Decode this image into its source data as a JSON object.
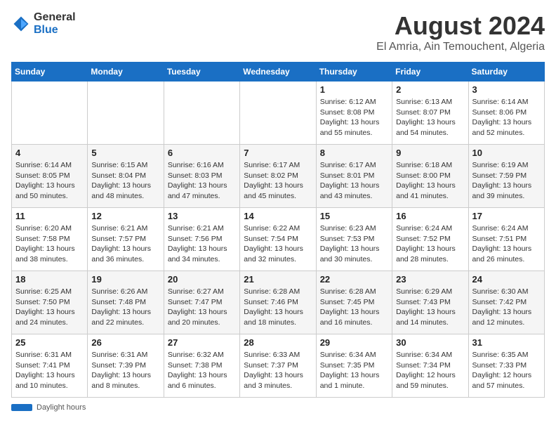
{
  "logo": {
    "text_general": "General",
    "text_blue": "Blue"
  },
  "title": "August 2024",
  "subtitle": "El Amria, Ain Temouchent, Algeria",
  "days_of_week": [
    "Sunday",
    "Monday",
    "Tuesday",
    "Wednesday",
    "Thursday",
    "Friday",
    "Saturday"
  ],
  "footer_label": "Daylight hours",
  "weeks": [
    [
      {
        "day": "",
        "info": ""
      },
      {
        "day": "",
        "info": ""
      },
      {
        "day": "",
        "info": ""
      },
      {
        "day": "",
        "info": ""
      },
      {
        "day": "1",
        "info": "Sunrise: 6:12 AM\nSunset: 8:08 PM\nDaylight: 13 hours and 55 minutes."
      },
      {
        "day": "2",
        "info": "Sunrise: 6:13 AM\nSunset: 8:07 PM\nDaylight: 13 hours and 54 minutes."
      },
      {
        "day": "3",
        "info": "Sunrise: 6:14 AM\nSunset: 8:06 PM\nDaylight: 13 hours and 52 minutes."
      }
    ],
    [
      {
        "day": "4",
        "info": "Sunrise: 6:14 AM\nSunset: 8:05 PM\nDaylight: 13 hours and 50 minutes."
      },
      {
        "day": "5",
        "info": "Sunrise: 6:15 AM\nSunset: 8:04 PM\nDaylight: 13 hours and 48 minutes."
      },
      {
        "day": "6",
        "info": "Sunrise: 6:16 AM\nSunset: 8:03 PM\nDaylight: 13 hours and 47 minutes."
      },
      {
        "day": "7",
        "info": "Sunrise: 6:17 AM\nSunset: 8:02 PM\nDaylight: 13 hours and 45 minutes."
      },
      {
        "day": "8",
        "info": "Sunrise: 6:17 AM\nSunset: 8:01 PM\nDaylight: 13 hours and 43 minutes."
      },
      {
        "day": "9",
        "info": "Sunrise: 6:18 AM\nSunset: 8:00 PM\nDaylight: 13 hours and 41 minutes."
      },
      {
        "day": "10",
        "info": "Sunrise: 6:19 AM\nSunset: 7:59 PM\nDaylight: 13 hours and 39 minutes."
      }
    ],
    [
      {
        "day": "11",
        "info": "Sunrise: 6:20 AM\nSunset: 7:58 PM\nDaylight: 13 hours and 38 minutes."
      },
      {
        "day": "12",
        "info": "Sunrise: 6:21 AM\nSunset: 7:57 PM\nDaylight: 13 hours and 36 minutes."
      },
      {
        "day": "13",
        "info": "Sunrise: 6:21 AM\nSunset: 7:56 PM\nDaylight: 13 hours and 34 minutes."
      },
      {
        "day": "14",
        "info": "Sunrise: 6:22 AM\nSunset: 7:54 PM\nDaylight: 13 hours and 32 minutes."
      },
      {
        "day": "15",
        "info": "Sunrise: 6:23 AM\nSunset: 7:53 PM\nDaylight: 13 hours and 30 minutes."
      },
      {
        "day": "16",
        "info": "Sunrise: 6:24 AM\nSunset: 7:52 PM\nDaylight: 13 hours and 28 minutes."
      },
      {
        "day": "17",
        "info": "Sunrise: 6:24 AM\nSunset: 7:51 PM\nDaylight: 13 hours and 26 minutes."
      }
    ],
    [
      {
        "day": "18",
        "info": "Sunrise: 6:25 AM\nSunset: 7:50 PM\nDaylight: 13 hours and 24 minutes."
      },
      {
        "day": "19",
        "info": "Sunrise: 6:26 AM\nSunset: 7:48 PM\nDaylight: 13 hours and 22 minutes."
      },
      {
        "day": "20",
        "info": "Sunrise: 6:27 AM\nSunset: 7:47 PM\nDaylight: 13 hours and 20 minutes."
      },
      {
        "day": "21",
        "info": "Sunrise: 6:28 AM\nSunset: 7:46 PM\nDaylight: 13 hours and 18 minutes."
      },
      {
        "day": "22",
        "info": "Sunrise: 6:28 AM\nSunset: 7:45 PM\nDaylight: 13 hours and 16 minutes."
      },
      {
        "day": "23",
        "info": "Sunrise: 6:29 AM\nSunset: 7:43 PM\nDaylight: 13 hours and 14 minutes."
      },
      {
        "day": "24",
        "info": "Sunrise: 6:30 AM\nSunset: 7:42 PM\nDaylight: 13 hours and 12 minutes."
      }
    ],
    [
      {
        "day": "25",
        "info": "Sunrise: 6:31 AM\nSunset: 7:41 PM\nDaylight: 13 hours and 10 minutes."
      },
      {
        "day": "26",
        "info": "Sunrise: 6:31 AM\nSunset: 7:39 PM\nDaylight: 13 hours and 8 minutes."
      },
      {
        "day": "27",
        "info": "Sunrise: 6:32 AM\nSunset: 7:38 PM\nDaylight: 13 hours and 6 minutes."
      },
      {
        "day": "28",
        "info": "Sunrise: 6:33 AM\nSunset: 7:37 PM\nDaylight: 13 hours and 3 minutes."
      },
      {
        "day": "29",
        "info": "Sunrise: 6:34 AM\nSunset: 7:35 PM\nDaylight: 13 hours and 1 minute."
      },
      {
        "day": "30",
        "info": "Sunrise: 6:34 AM\nSunset: 7:34 PM\nDaylight: 12 hours and 59 minutes."
      },
      {
        "day": "31",
        "info": "Sunrise: 6:35 AM\nSunset: 7:33 PM\nDaylight: 12 hours and 57 minutes."
      }
    ]
  ]
}
